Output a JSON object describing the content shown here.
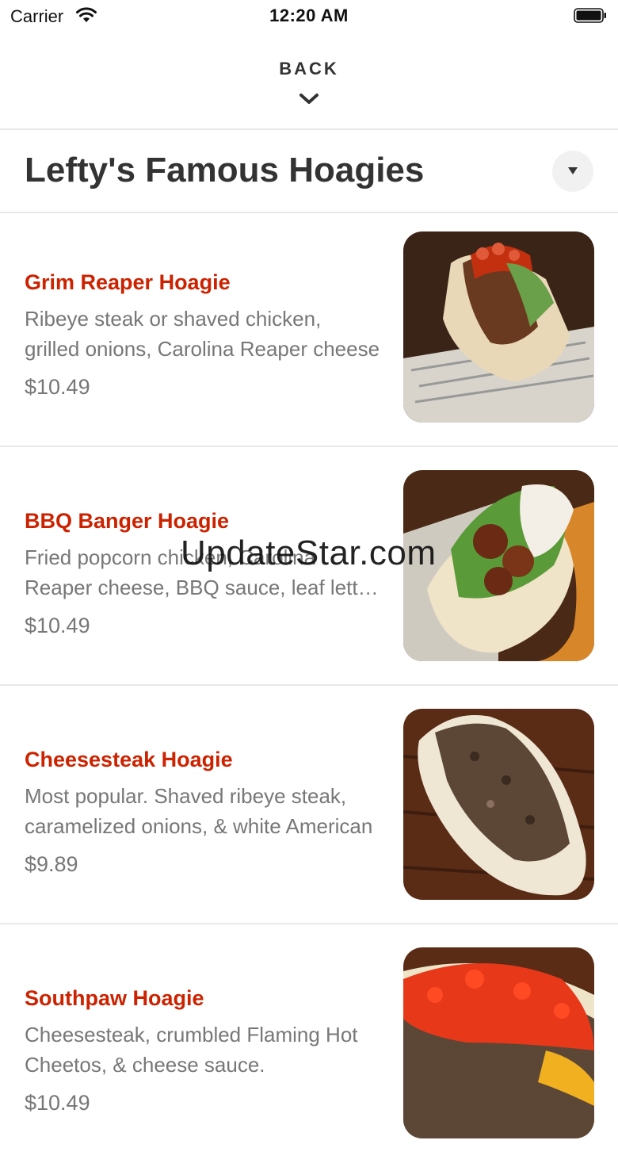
{
  "status_bar": {
    "carrier": "Carrier",
    "time": "12:20 AM"
  },
  "nav": {
    "back_label": "BACK"
  },
  "menu": {
    "title": "Lefty's Famous Hoagies"
  },
  "items": [
    {
      "name": "Grim Reaper Hoagie",
      "desc_line1": "Ribeye steak or shaved chicken,",
      "desc_line2": "grilled onions, Carolina Reaper cheese",
      "price": "$10.49",
      "photo": "grim-reaper-hoagie-photo"
    },
    {
      "name": "BBQ Banger Hoagie",
      "desc_line1": "Fried popcorn chicken, Carolina",
      "desc_line2": "Reaper cheese, BBQ sauce, leaf lettuce",
      "price": "$10.49",
      "photo": "bbq-banger-hoagie-photo"
    },
    {
      "name": "Cheesesteak Hoagie",
      "desc_line1": "Most popular. Shaved ribeye steak,",
      "desc_line2": "caramelized onions, & white American",
      "price": "$9.89",
      "photo": "cheesesteak-hoagie-photo"
    },
    {
      "name": "Southpaw Hoagie",
      "desc_line1": "Cheesesteak, crumbled Flaming Hot",
      "desc_line2": "Cheetos, & cheese sauce.",
      "price": "$10.49",
      "photo": "southpaw-hoagie-photo"
    }
  ],
  "watermark": "UpdateStar.com",
  "colors": {
    "accent": "#cc2200",
    "text": "#333333",
    "muted": "#777777",
    "divider": "#e8e8e8"
  }
}
